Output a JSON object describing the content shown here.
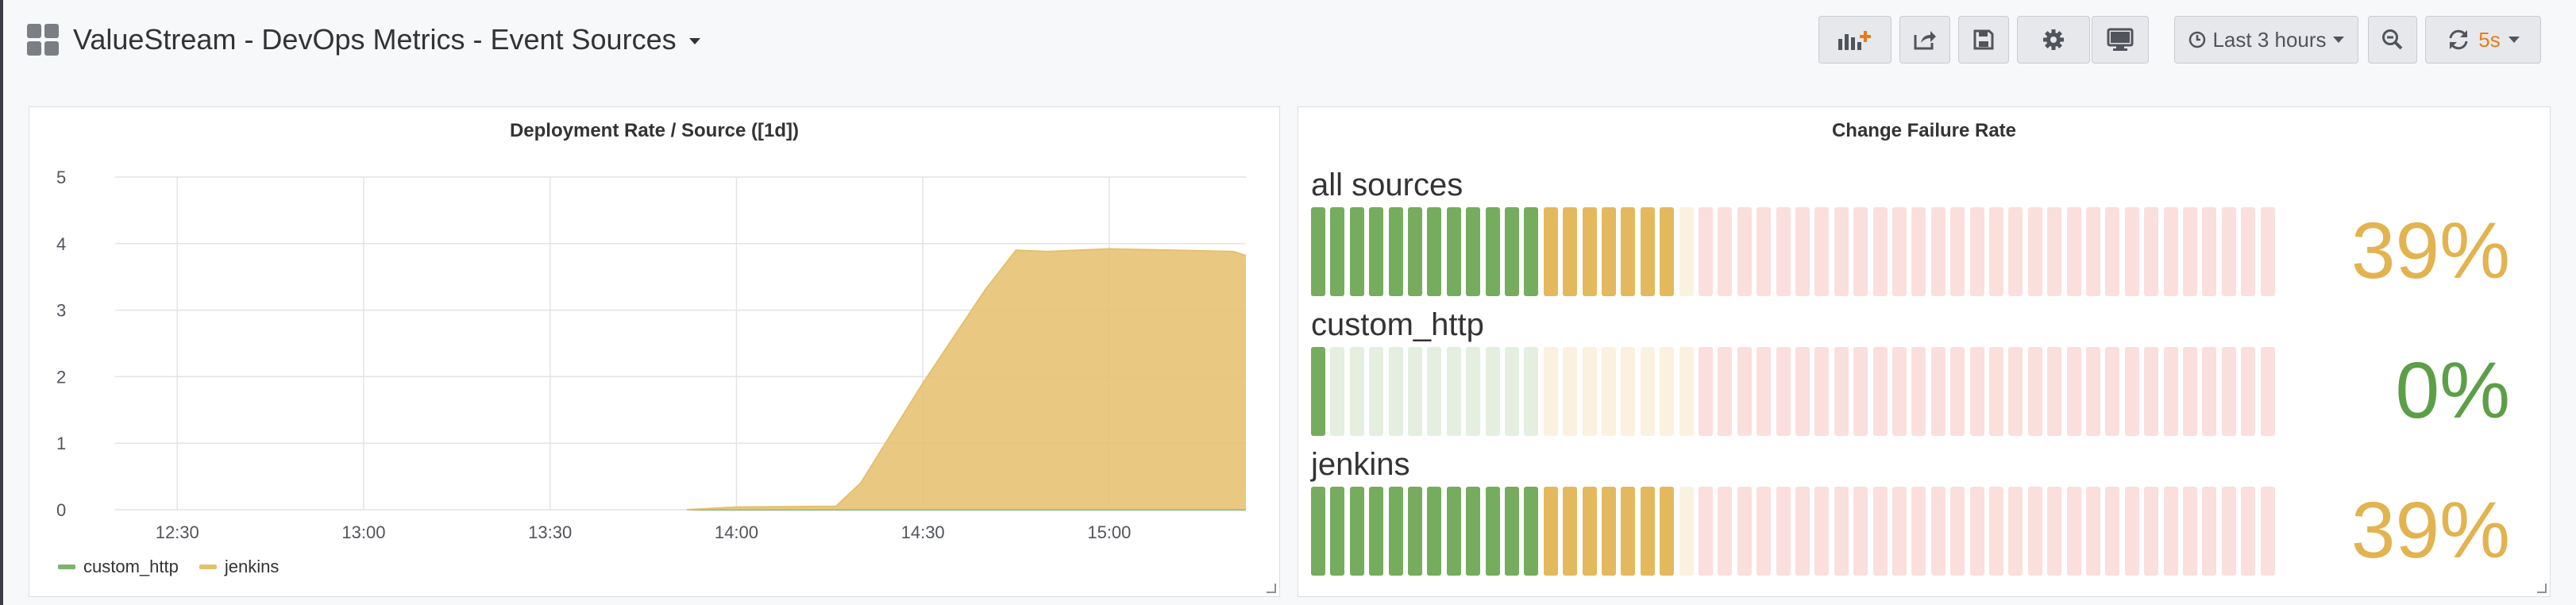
{
  "header": {
    "title": "ValueStream - DevOps Metrics - Event Sources",
    "time_range": "Last 3 hours",
    "refresh_interval": "5s"
  },
  "panels": {
    "deployment_rate": {
      "title": "Deployment Rate / Source ([1d])"
    },
    "change_failure_rate": {
      "title": "Change Failure Rate",
      "gauges": [
        {
          "label": "all sources",
          "value": "39%",
          "percent": 39,
          "color": "#e2b34f"
        },
        {
          "label": "custom_http",
          "value": "0%",
          "percent": 0,
          "color": "#5d9e48"
        },
        {
          "label": "jenkins",
          "value": "39%",
          "percent": 39,
          "color": "#e2b34f"
        }
      ],
      "thresholds": {
        "green_max": 25,
        "yellow_max": 40
      },
      "colors": {
        "green": "#6aa54f",
        "yellow": "#e2b34f",
        "red": "#e24d42"
      }
    }
  },
  "chart_data": {
    "type": "area",
    "title": "Deployment Rate / Source ([1d])",
    "x_ticks": [
      "12:30",
      "13:00",
      "13:30",
      "14:00",
      "14:30",
      "15:00"
    ],
    "y_ticks": [
      "0",
      "1",
      "2",
      "3",
      "4",
      "5"
    ],
    "ylim": [
      0,
      5
    ],
    "xlim": [
      "12:20",
      "15:22"
    ],
    "grid": true,
    "legend_position": "bottom-left",
    "series": [
      {
        "name": "custom_http",
        "color": "#7eb26d",
        "x": [
          "13:52",
          "15:22"
        ],
        "y": [
          0,
          0
        ]
      },
      {
        "name": "jenkins",
        "color": "#e5c06c",
        "x": [
          "13:52",
          "14:00",
          "14:16",
          "14:20",
          "14:30",
          "14:40",
          "14:45",
          "14:50",
          "15:00",
          "15:10",
          "15:20",
          "15:22"
        ],
        "y": [
          0,
          0.04,
          0.05,
          0.4,
          1.9,
          3.3,
          3.9,
          3.88,
          3.92,
          3.9,
          3.88,
          3.82
        ]
      }
    ]
  }
}
